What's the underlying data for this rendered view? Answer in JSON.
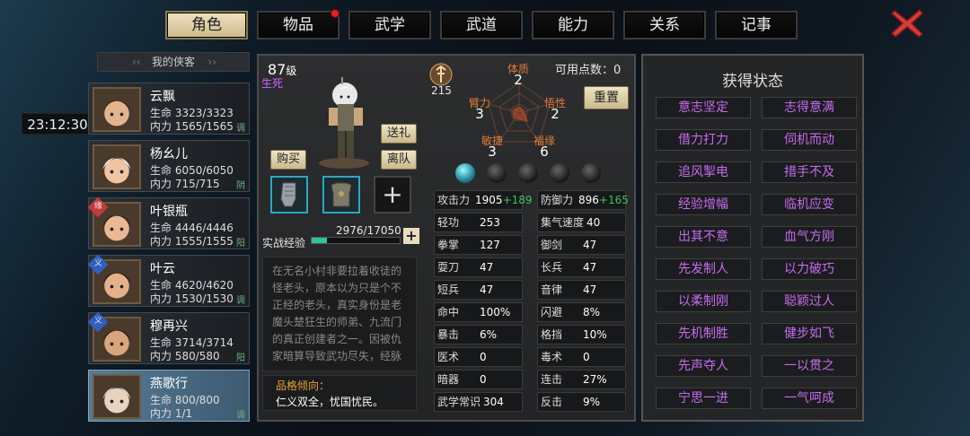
{
  "tabs": [
    {
      "label": "角色",
      "active": true,
      "dot": false
    },
    {
      "label": "物品",
      "active": false,
      "dot": true
    },
    {
      "label": "武学",
      "active": false,
      "dot": false
    },
    {
      "label": "武道",
      "active": false,
      "dot": false
    },
    {
      "label": "能力",
      "active": false,
      "dot": false
    },
    {
      "label": "关系",
      "active": false,
      "dot": false
    },
    {
      "label": "记事",
      "active": false,
      "dot": false
    }
  ],
  "clock": "23:12:30",
  "list_header": "我的侠客",
  "characters": [
    {
      "name": "云飘",
      "hp": "生命 3323/3323",
      "mp": "内力 1565/1565",
      "tag": "调",
      "badge": ""
    },
    {
      "name": "杨幺儿",
      "hp": "生命 6050/6050",
      "mp": "内力 715/715",
      "tag": "阴",
      "badge": ""
    },
    {
      "name": "叶银瓶",
      "hp": "生命 4446/4446",
      "mp": "内力 1555/1555",
      "tag": "阳",
      "badge": "缘"
    },
    {
      "name": "叶云",
      "hp": "生命 4620/4620",
      "mp": "内力 1530/1530",
      "tag": "调",
      "badge": "义"
    },
    {
      "name": "穆再兴",
      "hp": "生命 3714/3714",
      "mp": "内力 580/580",
      "tag": "阳",
      "badge": "义"
    },
    {
      "name": "燕歌行",
      "hp": "生命 800/800",
      "mp": "内力 1/1",
      "tag": "调",
      "badge": ""
    }
  ],
  "profile": {
    "level_num": "87",
    "level_unit": "级",
    "status": "生死",
    "btn_gift": "送礼",
    "btn_buy": "购买",
    "btn_leave": "离队",
    "exp_label": "实战经验",
    "exp_text": "2976/17050",
    "exp_fraction": 0.175,
    "story": "在无名小村非要拉着收徒的怪老头，原本以为只是个不正经的老头，真实身份是老魔头楚狂生的师弟、九流门的真正创建者之一。因被仇家暗算导致武功尽失，经脉",
    "trait_title": "品格倾向：",
    "trait_text": "仁义双全，忧国忧民。"
  },
  "stats_head": {
    "power": "215",
    "points_label": "可用点数：",
    "points": "0",
    "reset": "重置",
    "hex": [
      {
        "label": "体质",
        "value": "2"
      },
      {
        "label": "悟性",
        "value": "2"
      },
      {
        "label": "福缘",
        "value": "6"
      },
      {
        "label": "敏捷",
        "value": "3"
      },
      {
        "label": "臂力",
        "value": "3"
      }
    ]
  },
  "attributes": [
    [
      {
        "k": "攻击力",
        "v": "1905",
        "g": "+189"
      },
      {
        "k": "防御力",
        "v": "896",
        "g": "+165"
      }
    ],
    [
      {
        "k": "轻功",
        "v": "253",
        "g": ""
      },
      {
        "k": "集气速度",
        "v": "40",
        "g": ""
      }
    ],
    [
      {
        "k": "拳掌",
        "v": "127",
        "g": ""
      },
      {
        "k": "御剑",
        "v": "47",
        "g": ""
      }
    ],
    [
      {
        "k": "耍刀",
        "v": "47",
        "g": ""
      },
      {
        "k": "长兵",
        "v": "47",
        "g": ""
      }
    ],
    [
      {
        "k": "短兵",
        "v": "47",
        "g": ""
      },
      {
        "k": "音律",
        "v": "47",
        "g": ""
      }
    ],
    [
      {
        "k": "命中",
        "v": "100%",
        "g": ""
      },
      {
        "k": "闪避",
        "v": "8%",
        "g": ""
      }
    ],
    [
      {
        "k": "暴击",
        "v": "6%",
        "g": ""
      },
      {
        "k": "格挡",
        "v": "10%",
        "g": ""
      }
    ],
    [
      {
        "k": "医术",
        "v": "0",
        "g": ""
      },
      {
        "k": "毒术",
        "v": "0",
        "g": ""
      }
    ],
    [
      {
        "k": "暗器",
        "v": "0",
        "g": ""
      },
      {
        "k": "连击",
        "v": "27%",
        "g": ""
      }
    ],
    [
      {
        "k": "武学常识",
        "v": "304",
        "g": ""
      },
      {
        "k": "反击",
        "v": "9%",
        "g": ""
      }
    ]
  ],
  "status_panel": {
    "title": "获得状态",
    "items": [
      "意志坚定",
      "志得意满",
      "借力打力",
      "伺机而动",
      "追风掣电",
      "措手不及",
      "经验增幅",
      "临机应变",
      "出其不意",
      "血气方刚",
      "先发制人",
      "以力破巧",
      "以柔制刚",
      "聪颖过人",
      "先机制胜",
      "健步如飞",
      "先声夺人",
      "一以贯之",
      "宁思一进",
      "一气呵成"
    ]
  },
  "colors": {
    "accent": "#cdb98b",
    "status_text": "#c56bf0",
    "exp": "#2dc1a0",
    "gain": "#3ec25b"
  }
}
